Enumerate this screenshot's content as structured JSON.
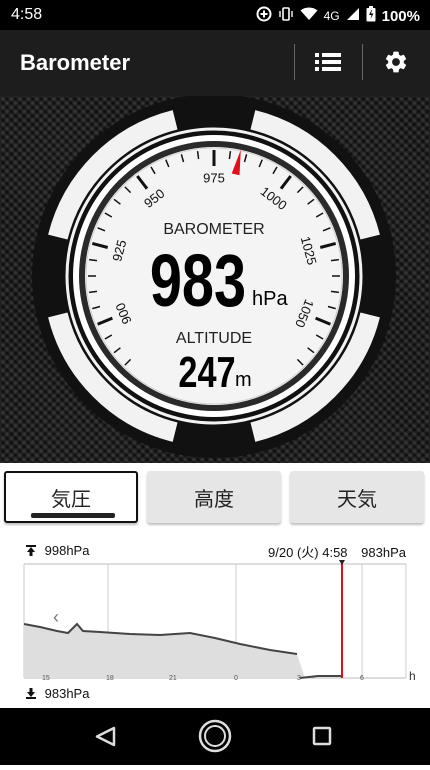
{
  "status_bar": {
    "time": "4:58",
    "network": "4G",
    "battery": "100%"
  },
  "app_bar": {
    "title": "Barometer"
  },
  "gauge": {
    "ticks": [
      "900",
      "925",
      "950",
      "975",
      "1000",
      "1025",
      "1050"
    ],
    "pressure_label": "BAROMETER",
    "pressure_value": "983",
    "pressure_unit": "hPa",
    "altitude_label": "ALTITUDE",
    "altitude_value": "247",
    "altitude_unit": "m",
    "needle_value": 983,
    "accent": "#e0101b"
  },
  "tabs": [
    {
      "label": "気圧",
      "active": true
    },
    {
      "label": "高度",
      "active": false
    },
    {
      "label": "天気",
      "active": false
    }
  ],
  "graph": {
    "max_label": "998hPa",
    "min_label": "983hPa",
    "cursor_date": "9/20 (火) 4:58",
    "cursor_value": "983hPa",
    "x_ticks": [
      "15",
      "18",
      "21",
      "0",
      "3",
      "6"
    ],
    "x_unit": "h",
    "prev_glyph": "‹"
  }
}
